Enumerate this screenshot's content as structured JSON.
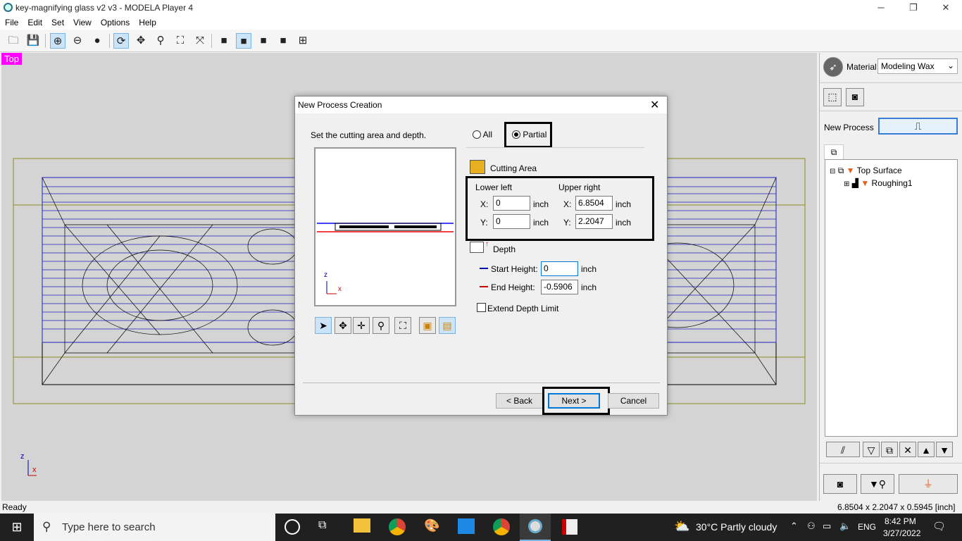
{
  "window": {
    "title": "key-magnifying glass v2 v3 - MODELA Player 4"
  },
  "menu": [
    "File",
    "Edit",
    "Set",
    "View",
    "Options",
    "Help"
  ],
  "viewport": {
    "label": "Top",
    "axis_z": "z",
    "axis_x": "x"
  },
  "right_panel": {
    "material_label": "Material",
    "material_value": "Modeling Wax",
    "new_process_label": "New Process",
    "tree": {
      "root": "Top Surface",
      "child": "Roughing1"
    }
  },
  "dialog": {
    "title": "New Process Creation",
    "instruction": "Set the cutting area and depth.",
    "radio_all": "All",
    "radio_partial": "Partial",
    "cutting_area_label": "Cutting Area",
    "lower_left_label": "Lower left",
    "upper_right_label": "Upper right",
    "x_label": "X:",
    "y_label": "Y:",
    "unit": "inch",
    "lower_left_x": "0",
    "lower_left_y": "0",
    "upper_right_x": "6.8504",
    "upper_right_y": "2.2047",
    "depth_label": "Depth",
    "start_height_label": "Start Height:",
    "start_height_value": "0",
    "end_height_label": "End Height:",
    "end_height_value": "-0.5906",
    "extend_depth_label": "Extend Depth Limit",
    "preview_axis_z": "z",
    "preview_axis_x": "x",
    "back_button": "< Back",
    "next_button": "Next >",
    "cancel_button": "Cancel"
  },
  "statusbar": {
    "left": "Ready",
    "right": "6.8504 x 2.2047 x 0.5945 [inch]"
  },
  "taskbar": {
    "search_placeholder": "Type here to search",
    "weather": "30°C  Partly cloudy",
    "language": "ENG",
    "time": "8:42 PM",
    "date": "3/27/2022"
  }
}
